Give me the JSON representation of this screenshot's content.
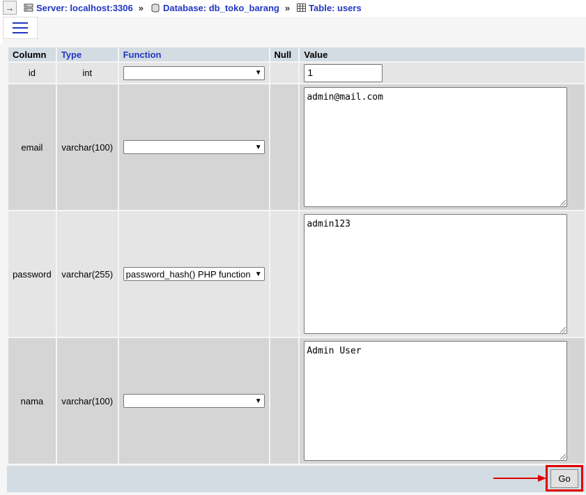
{
  "breadcrumb": {
    "nav_arrow": "→",
    "server": "Server: localhost:3306",
    "database": "Database: db_toko_barang",
    "table": "Table: users",
    "separator": "»"
  },
  "table": {
    "headers": [
      "Column",
      "Type",
      "Function",
      "Null",
      "Value"
    ],
    "rows": [
      {
        "column": "id",
        "type": "int",
        "function": "",
        "value": "1"
      },
      {
        "column": "email",
        "type": "varchar(100)",
        "function": "",
        "value": "admin@mail.com"
      },
      {
        "column": "password",
        "type": "varchar(255)",
        "function": "password_hash() PHP function",
        "value": "admin123"
      },
      {
        "column": "nama",
        "type": "varchar(100)",
        "function": "",
        "value": "Admin User"
      }
    ]
  },
  "footer": {
    "go_label": "Go"
  },
  "colors": {
    "link_blue": "#2136c2",
    "header_bg": "#d3dce3",
    "highlight_red": "#e00000"
  }
}
